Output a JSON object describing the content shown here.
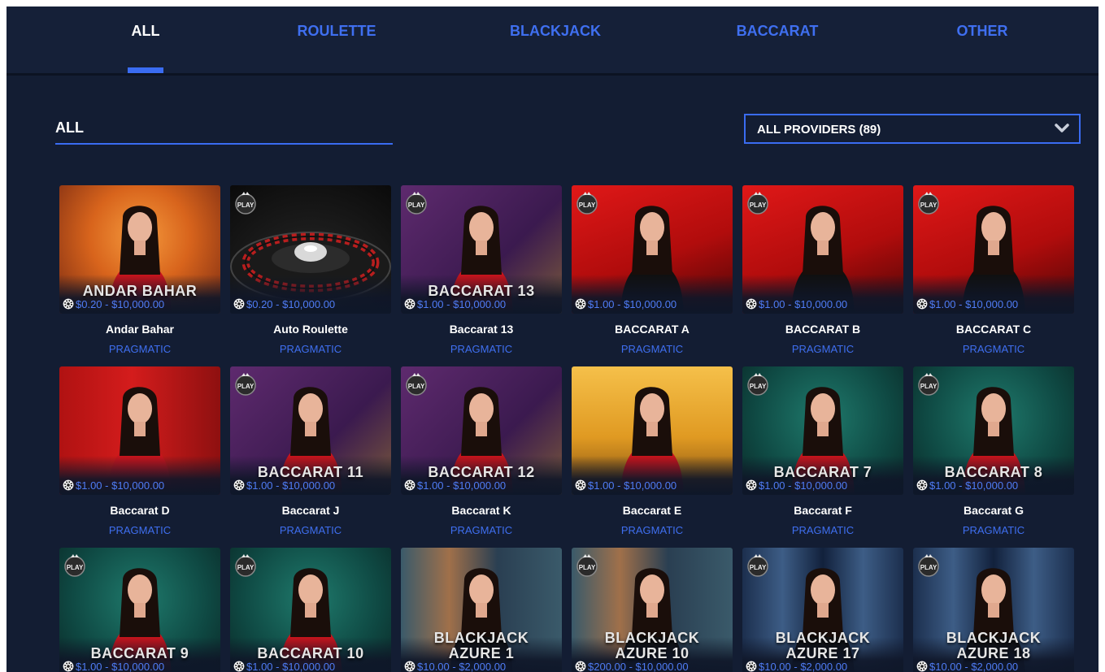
{
  "tabs": [
    {
      "label": "ALL",
      "active": true
    },
    {
      "label": "ROULETTE",
      "active": false
    },
    {
      "label": "BLACKJACK",
      "active": false
    },
    {
      "label": "BACCARAT",
      "active": false
    },
    {
      "label": "OTHER",
      "active": false
    }
  ],
  "filter": {
    "value": "ALL"
  },
  "providers": {
    "selected": "ALL PROVIDERS (89)"
  },
  "colors": {
    "background": "#131d33",
    "accent": "#3a6cf2",
    "provider_text": "#3f6ff0"
  },
  "games": [
    {
      "name": "Andar Bahar",
      "provider": "PRAGMATIC",
      "limit": "$0.20 - $10,000.00",
      "overlay": "ANDAR BAHAR",
      "theme": "orange",
      "play_badge": false
    },
    {
      "name": "Auto Roulette",
      "provider": "PRAGMATIC",
      "limit": "$0.20 - $10,000.00",
      "overlay": "",
      "theme": "roulette",
      "play_badge": true
    },
    {
      "name": "Baccarat 13",
      "provider": "PRAGMATIC",
      "limit": "$1.00 - $10,000.00",
      "overlay": "BACCARAT 13",
      "theme": "purple",
      "play_badge": true
    },
    {
      "name": "BACCARAT A",
      "provider": "PRAGMATIC",
      "limit": "$1.00 - $10,000.00",
      "overlay": "",
      "theme": "red",
      "play_badge": true
    },
    {
      "name": "BACCARAT B",
      "provider": "PRAGMATIC",
      "limit": "$1.00 - $10,000.00",
      "overlay": "",
      "theme": "red",
      "play_badge": true
    },
    {
      "name": "BACCARAT C",
      "provider": "PRAGMATIC",
      "limit": "$1.00 - $10,000.00",
      "overlay": "",
      "theme": "red",
      "play_badge": true
    },
    {
      "name": "Baccarat D",
      "provider": "PRAGMATIC",
      "limit": "$1.00 - $10,000.00",
      "overlay": "",
      "theme": "redgold",
      "play_badge": false
    },
    {
      "name": "Baccarat J",
      "provider": "PRAGMATIC",
      "limit": "$1.00 - $10,000.00",
      "overlay": "BACCARAT 11",
      "theme": "purple",
      "play_badge": true
    },
    {
      "name": "Baccarat K",
      "provider": "PRAGMATIC",
      "limit": "$1.00 - $10,000.00",
      "overlay": "BACCARAT 12",
      "theme": "purple",
      "play_badge": true
    },
    {
      "name": "Baccarat E",
      "provider": "PRAGMATIC",
      "limit": "$1.00 - $10,000.00",
      "overlay": "",
      "theme": "gold",
      "play_badge": false
    },
    {
      "name": "Baccarat F",
      "provider": "PRAGMATIC",
      "limit": "$1.00 - $10,000.00",
      "overlay": "BACCARAT 7",
      "theme": "green",
      "play_badge": true
    },
    {
      "name": "Baccarat G",
      "provider": "PRAGMATIC",
      "limit": "$1.00 - $10,000.00",
      "overlay": "BACCARAT 8",
      "theme": "green",
      "play_badge": true
    },
    {
      "name": "",
      "provider": "",
      "limit": "$1.00 - $10,000.00",
      "overlay": "BACCARAT 9",
      "theme": "green",
      "play_badge": true
    },
    {
      "name": "",
      "provider": "",
      "limit": "$1.00 - $10,000.00",
      "overlay": "BACCARAT 10",
      "theme": "green",
      "play_badge": true
    },
    {
      "name": "",
      "provider": "",
      "limit": "$10.00 - $2,000.00",
      "overlay": "BLACKJACK\nAZURE 1",
      "theme": "teal",
      "play_badge": false
    },
    {
      "name": "",
      "provider": "",
      "limit": "$200.00 - $10,000.00",
      "overlay": "BLACKJACK\nAZURE 10",
      "theme": "teal",
      "play_badge": true
    },
    {
      "name": "",
      "provider": "",
      "limit": "$10.00 - $2,000.00",
      "overlay": "BLACKJACK\nAZURE 17",
      "theme": "blue",
      "play_badge": true
    },
    {
      "name": "",
      "provider": "",
      "limit": "$10.00 - $2,000.00",
      "overlay": "BLACKJACK\nAZURE 18",
      "theme": "blue",
      "play_badge": true
    }
  ]
}
